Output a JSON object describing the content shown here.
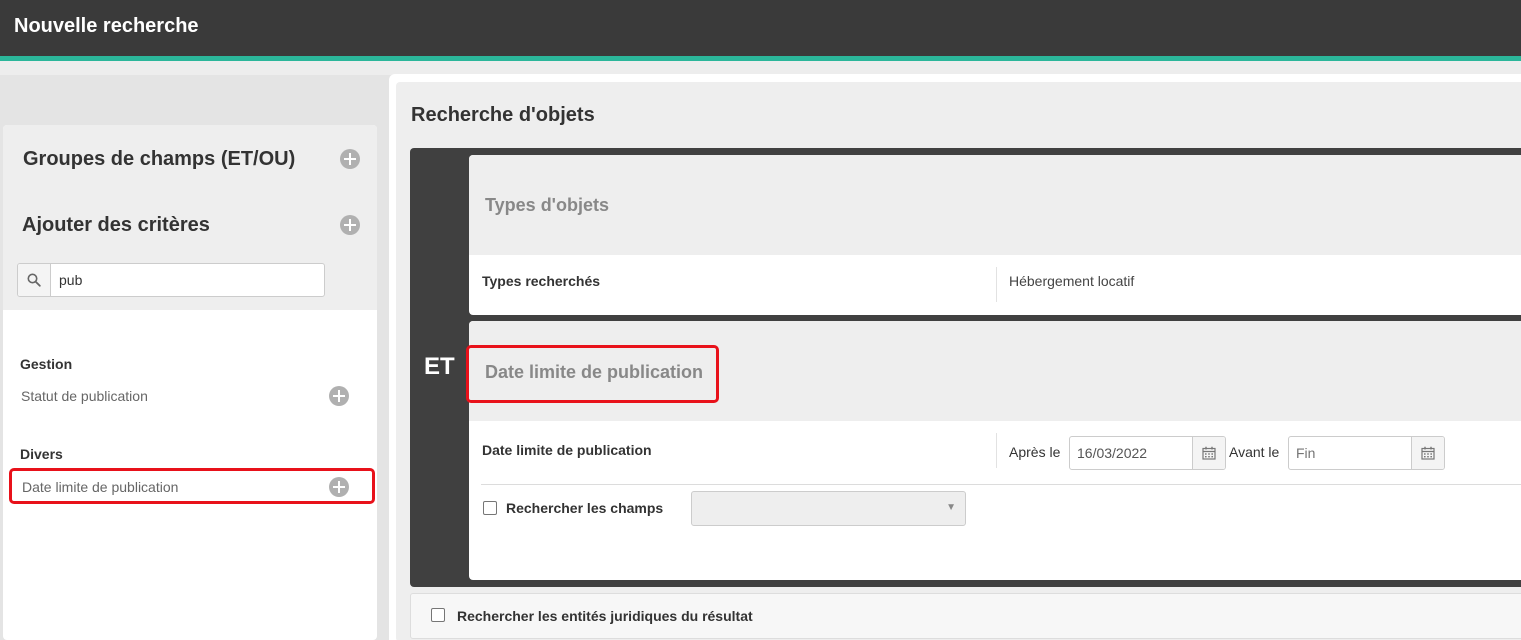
{
  "header": {
    "title": "Nouvelle recherche"
  },
  "sidebar": {
    "groups_heading": "Groupes de champs (ET/OU)",
    "criteria_heading": "Ajouter des critères",
    "search": {
      "value": "pub"
    },
    "sections": [
      {
        "title": "Gestion",
        "items": [
          {
            "label": "Statut de publication"
          }
        ]
      },
      {
        "title": "Divers",
        "items": [
          {
            "label": "Date limite de publication"
          }
        ]
      }
    ]
  },
  "main": {
    "title": "Recherche d'objets",
    "operator": "ET",
    "cards": [
      {
        "title": "Types d'objets",
        "rows": [
          {
            "label": "Types recherchés",
            "value": "Hébergement locatif"
          }
        ]
      },
      {
        "title": "Date limite de publication",
        "field_label": "Date limite de publication",
        "after_label": "Après le",
        "after_value": "16/03/2022",
        "before_label": "Avant le",
        "before_placeholder": "Fin",
        "search_fields_label": "Rechercher les champs"
      }
    ],
    "legal_entities_label": "Rechercher les entités juridiques du résultat"
  },
  "colors": {
    "accent": "#2bb69a",
    "header_bg": "#3a3a3a",
    "highlight": "#e8111a",
    "operator_bg": "#404040"
  }
}
